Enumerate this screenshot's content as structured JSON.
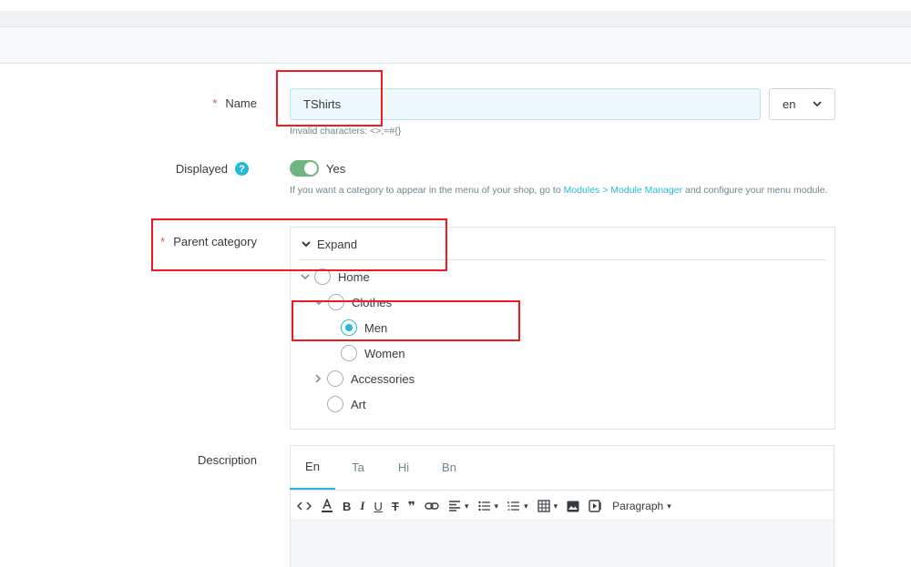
{
  "form": {
    "name": {
      "label": "Name",
      "required_mark": "*",
      "value": "TShirts",
      "language": "en",
      "helper": "Invalid characters: <>;=#{}"
    },
    "displayed": {
      "label": "Displayed",
      "help_icon": "question-circle-icon",
      "toggle_state": "on",
      "toggle_label": "Yes",
      "helper_prefix": "If you want a category to appear in the menu of your shop, go to ",
      "helper_link": "Modules > Module Manager",
      "helper_suffix": " and configure your menu module."
    },
    "parent_category": {
      "label": "Parent category",
      "required_mark": "*",
      "expand_label": "Expand",
      "tree": [
        {
          "label": "Home",
          "expanded": true,
          "checked": false
        },
        {
          "label": "Clothes",
          "expanded": true,
          "checked": false
        },
        {
          "label": "Men",
          "checked": true
        },
        {
          "label": "Women",
          "checked": false
        },
        {
          "label": "Accessories",
          "expanded": false,
          "checked": false
        },
        {
          "label": "Art",
          "checked": false
        }
      ]
    },
    "description": {
      "label": "Description",
      "tabs": [
        "En",
        "Ta",
        "Hi",
        "Bn"
      ],
      "active_tab": "En",
      "toolbar": {
        "paragraph_label": "Paragraph"
      }
    }
  },
  "colors": {
    "accent": "#25b9d7",
    "toggle_on": "#70b580",
    "required": "#e04a4a",
    "annotation": "#ee1b22"
  }
}
